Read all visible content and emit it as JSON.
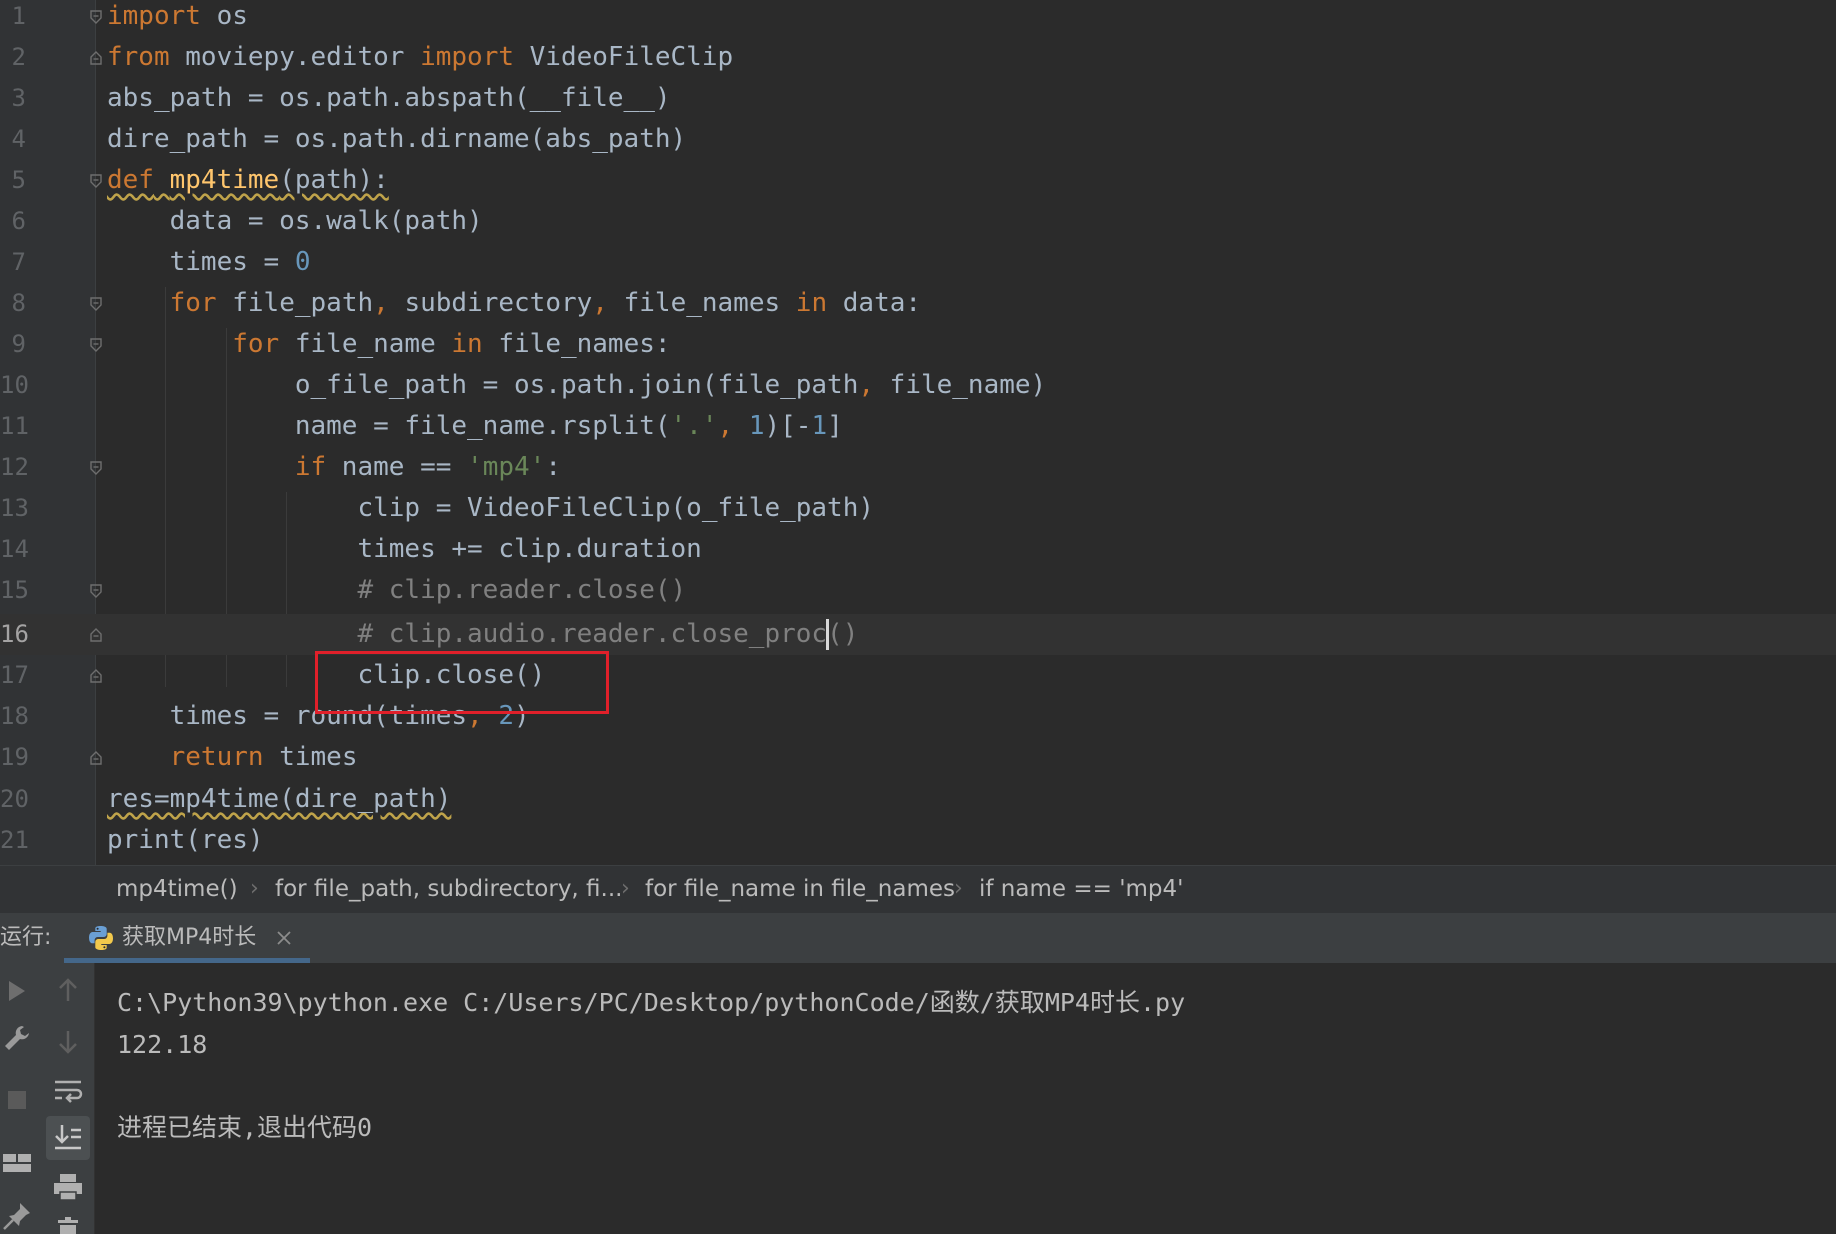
{
  "editor": {
    "current_line": 16,
    "lines": [
      {
        "n": "1"
      },
      {
        "n": "2"
      },
      {
        "n": "3"
      },
      {
        "n": "4"
      },
      {
        "n": "5"
      },
      {
        "n": "6"
      },
      {
        "n": "7"
      },
      {
        "n": "8"
      },
      {
        "n": "9"
      },
      {
        "n": "10"
      },
      {
        "n": "11"
      },
      {
        "n": "12"
      },
      {
        "n": "13"
      },
      {
        "n": "14"
      },
      {
        "n": "15"
      },
      {
        "n": "16"
      },
      {
        "n": "17"
      },
      {
        "n": "18"
      },
      {
        "n": "19"
      },
      {
        "n": "20"
      },
      {
        "n": "21"
      }
    ],
    "tokens": {
      "l1": [
        "import",
        " os"
      ],
      "l2": [
        "from",
        " moviepy.editor ",
        "import",
        " VideoFileClip"
      ],
      "l3": [
        "abs_path = os.path.abspath(__file__)"
      ],
      "l4": [
        "dire_path = os.path.dirname(abs_path)"
      ],
      "l5": [
        "def",
        " ",
        "mp4time",
        "(path):"
      ],
      "l6": [
        "    data = os.walk(path)"
      ],
      "l7": [
        "    times = ",
        "0"
      ],
      "l8": [
        "    ",
        "for",
        " file_path",
        ",",
        " subdirectory",
        ",",
        " file_names ",
        "in",
        " data:"
      ],
      "l9": [
        "        ",
        "for",
        " file_name ",
        "in",
        " file_names:"
      ],
      "l10": [
        "            o_file_path = os.path.join(file_path",
        ",",
        " file_name)"
      ],
      "l11": [
        "            name = file_name.rsplit(",
        "'.'",
        ", ",
        "1",
        ")[-",
        "1",
        "]"
      ],
      "l12": [
        "            ",
        "if",
        " name == ",
        "'mp4'",
        ":"
      ],
      "l13": [
        "                clip = VideoFileClip(o_file_path)"
      ],
      "l14": [
        "                times += clip.duration"
      ],
      "l15": [
        "                ",
        "# clip.reader.close()"
      ],
      "l16": [
        "                ",
        "# clip.audio.reader.close_proc()"
      ],
      "l17": [
        "                clip.close()"
      ],
      "l18": [
        "    times = round(times",
        ",",
        " ",
        "2",
        ")"
      ],
      "l19": [
        "    ",
        "return",
        " times"
      ],
      "l20": [
        "res=mp4time(dire_path)"
      ],
      "l21": [
        "print(res)"
      ]
    }
  },
  "breadcrumb": {
    "items": [
      "mp4time()",
      "for file_path, subdirectory, fi...",
      "for file_name in file_names",
      "if name == 'mp4'"
    ],
    "separator": "›"
  },
  "run": {
    "label": "运行:",
    "tab_label": "获取MP4时长",
    "tab_close": "×",
    "console": {
      "command": "C:\\Python39\\python.exe C:/Users/PC/Desktop/pythonCode/函数/获取MP4时长.py",
      "output": "122.18",
      "exit_message": "进程已结束,退出代码0"
    },
    "toolbar_icons": [
      "play-icon",
      "wrench-icon",
      "stop-icon",
      "layout-icon",
      "pin-icon",
      "arrow-up-icon",
      "arrow-down-icon",
      "soft-wrap-icon",
      "scroll-to-end-icon",
      "print-icon",
      "trash-icon"
    ]
  },
  "colors": {
    "keyword": "#cc7832",
    "number": "#6897bb",
    "string": "#6a8759",
    "comment": "#808080",
    "function": "#ffc66d",
    "text": "#a9b7c6",
    "highlight_box": "#e0202a"
  }
}
